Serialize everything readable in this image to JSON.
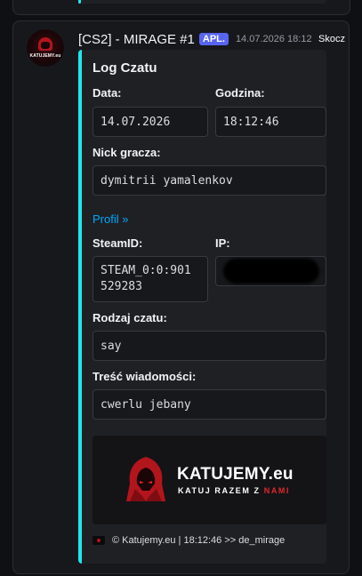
{
  "message": {
    "author": "[CS2] - MIRAGE #1",
    "tag": "APL.",
    "timestamp": "14.07.2026 18:12",
    "skip_label": "Skocz",
    "avatar_text": "KATUJEMY.eu"
  },
  "embed": {
    "title": "Log Czatu",
    "fields": {
      "date": {
        "label": "Data:",
        "value": "14.07.2026"
      },
      "time": {
        "label": "Godzina:",
        "value": "18:12:46"
      },
      "nick": {
        "label": "Nick gracza:",
        "value": "dymitrii yamalenkov"
      },
      "profile_link": "Profil »",
      "steamid": {
        "label": "SteamID:",
        "value_line1": "STEAM_0:0:901",
        "value_line2": "529283"
      },
      "ip": {
        "label": "IP:",
        "value": ""
      },
      "chat_type": {
        "label": "Rodzaj czatu:",
        "value": "say"
      },
      "content": {
        "label": "Treść wiadomości:",
        "value": "cwerlu jebany"
      }
    },
    "banner": {
      "brand": "KATUJEMY.eu",
      "slogan_main": "KATUJ RAZEM Z ",
      "slogan_highlight": "NAMI"
    },
    "footer": "© Katujemy.eu | 18:12:46 >> de_mirage"
  },
  "colors": {
    "accent": "#1ee8ea",
    "tag": "#5865f2",
    "link": "#00a8fc",
    "brand_red": "#e3242b"
  }
}
